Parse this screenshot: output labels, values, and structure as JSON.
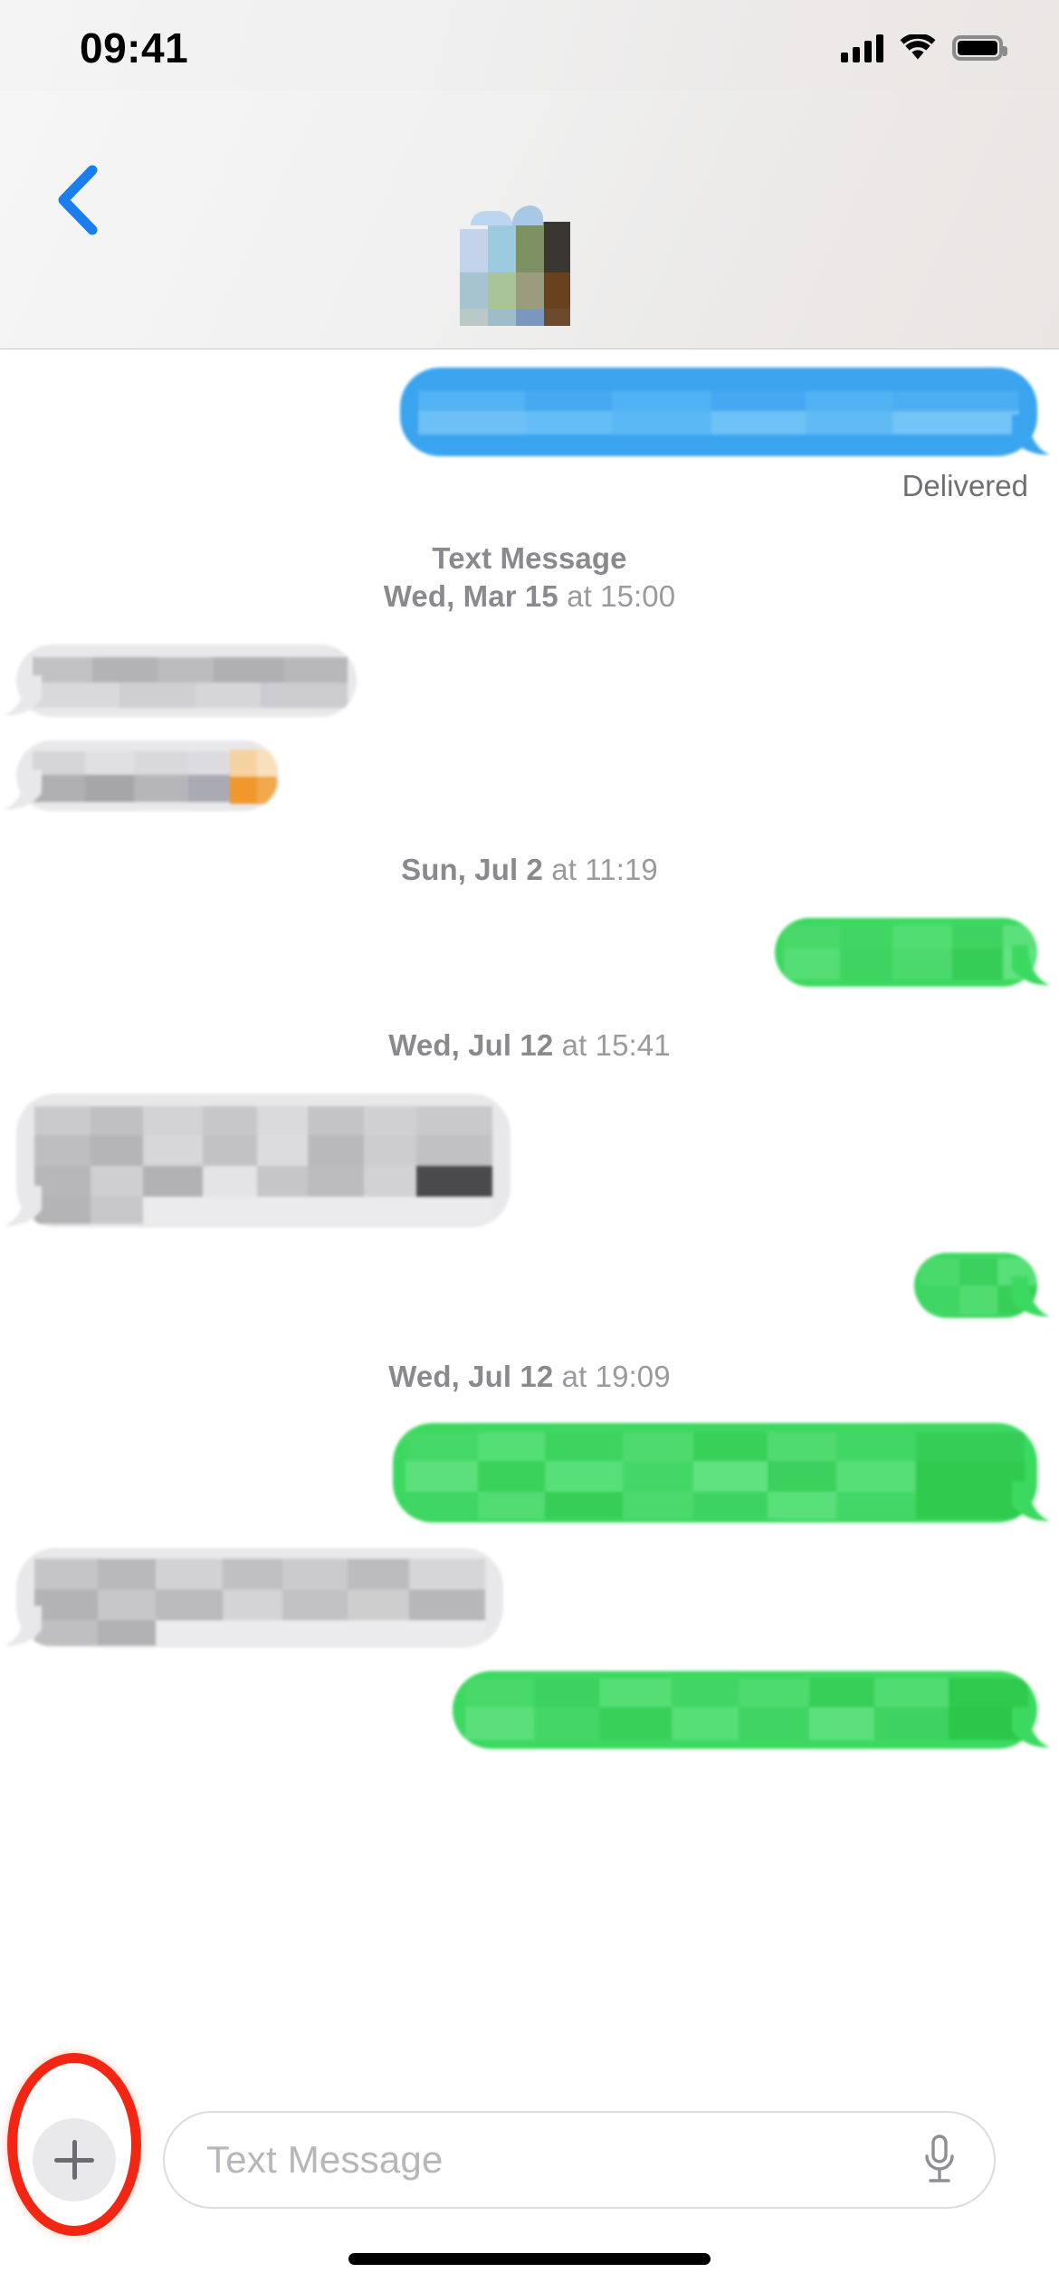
{
  "status_bar": {
    "time": "09:41",
    "icons": [
      "cellular-signal-icon",
      "wifi-icon",
      "battery-icon"
    ],
    "battery_full": true
  },
  "nav_header": {
    "back_icon": "chevron-left-icon",
    "back_color": "#1a7ef0",
    "avatar_label": "contact-avatar",
    "avatar_redacted": true,
    "contact_name_visible": false
  },
  "conversation": {
    "messages": [
      {
        "id": "msg-1",
        "side": "outgoing",
        "kind": "imessage",
        "color": "#3ba4ef",
        "redacted": true,
        "status": "Delivered"
      },
      {
        "id": "msg-2",
        "side": "incoming",
        "kind": "sms",
        "color": "#e8e8ea",
        "redacted": true
      },
      {
        "id": "msg-3",
        "side": "incoming",
        "kind": "sms",
        "color": "#e8e8ea",
        "redacted": true,
        "has_emoji": true,
        "emoji_color": "#f0982c"
      },
      {
        "id": "msg-4",
        "side": "outgoing",
        "kind": "sms",
        "color": "#3cd960",
        "redacted": true
      },
      {
        "id": "msg-5",
        "side": "incoming",
        "kind": "sms",
        "color": "#e8e8ea",
        "redacted": true
      },
      {
        "id": "msg-6",
        "side": "outgoing",
        "kind": "sms",
        "color": "#3cd960",
        "redacted": true
      },
      {
        "id": "msg-7",
        "side": "outgoing",
        "kind": "sms",
        "color": "#3cd960",
        "redacted": true
      },
      {
        "id": "msg-8",
        "side": "incoming",
        "kind": "sms",
        "color": "#e8e8ea",
        "redacted": true
      },
      {
        "id": "msg-9",
        "side": "outgoing",
        "kind": "sms",
        "color": "#3cd960",
        "redacted": true
      }
    ],
    "delivered_label": "Delivered",
    "timestamps": [
      {
        "id": "ts-1",
        "label": "Text Message",
        "date": "Wed, Mar 15",
        "time": "at 15:00"
      },
      {
        "id": "ts-2",
        "label": "",
        "date": "Sun, Jul 2",
        "time": "at 11:19"
      },
      {
        "id": "ts-3",
        "label": "",
        "date": "Wed, Jul 12",
        "time": "at 15:41"
      },
      {
        "id": "ts-4",
        "label": "",
        "date": "Wed, Jul 12",
        "time": "at 19:09"
      }
    ]
  },
  "input_bar": {
    "plus_label": "+",
    "plus_icon": "plus-icon",
    "placeholder": "Text Message",
    "mic_icon": "microphone-icon",
    "highlight_color": "#f22613",
    "highlight_target": "plus-button"
  },
  "home_indicator": "home-indicator"
}
